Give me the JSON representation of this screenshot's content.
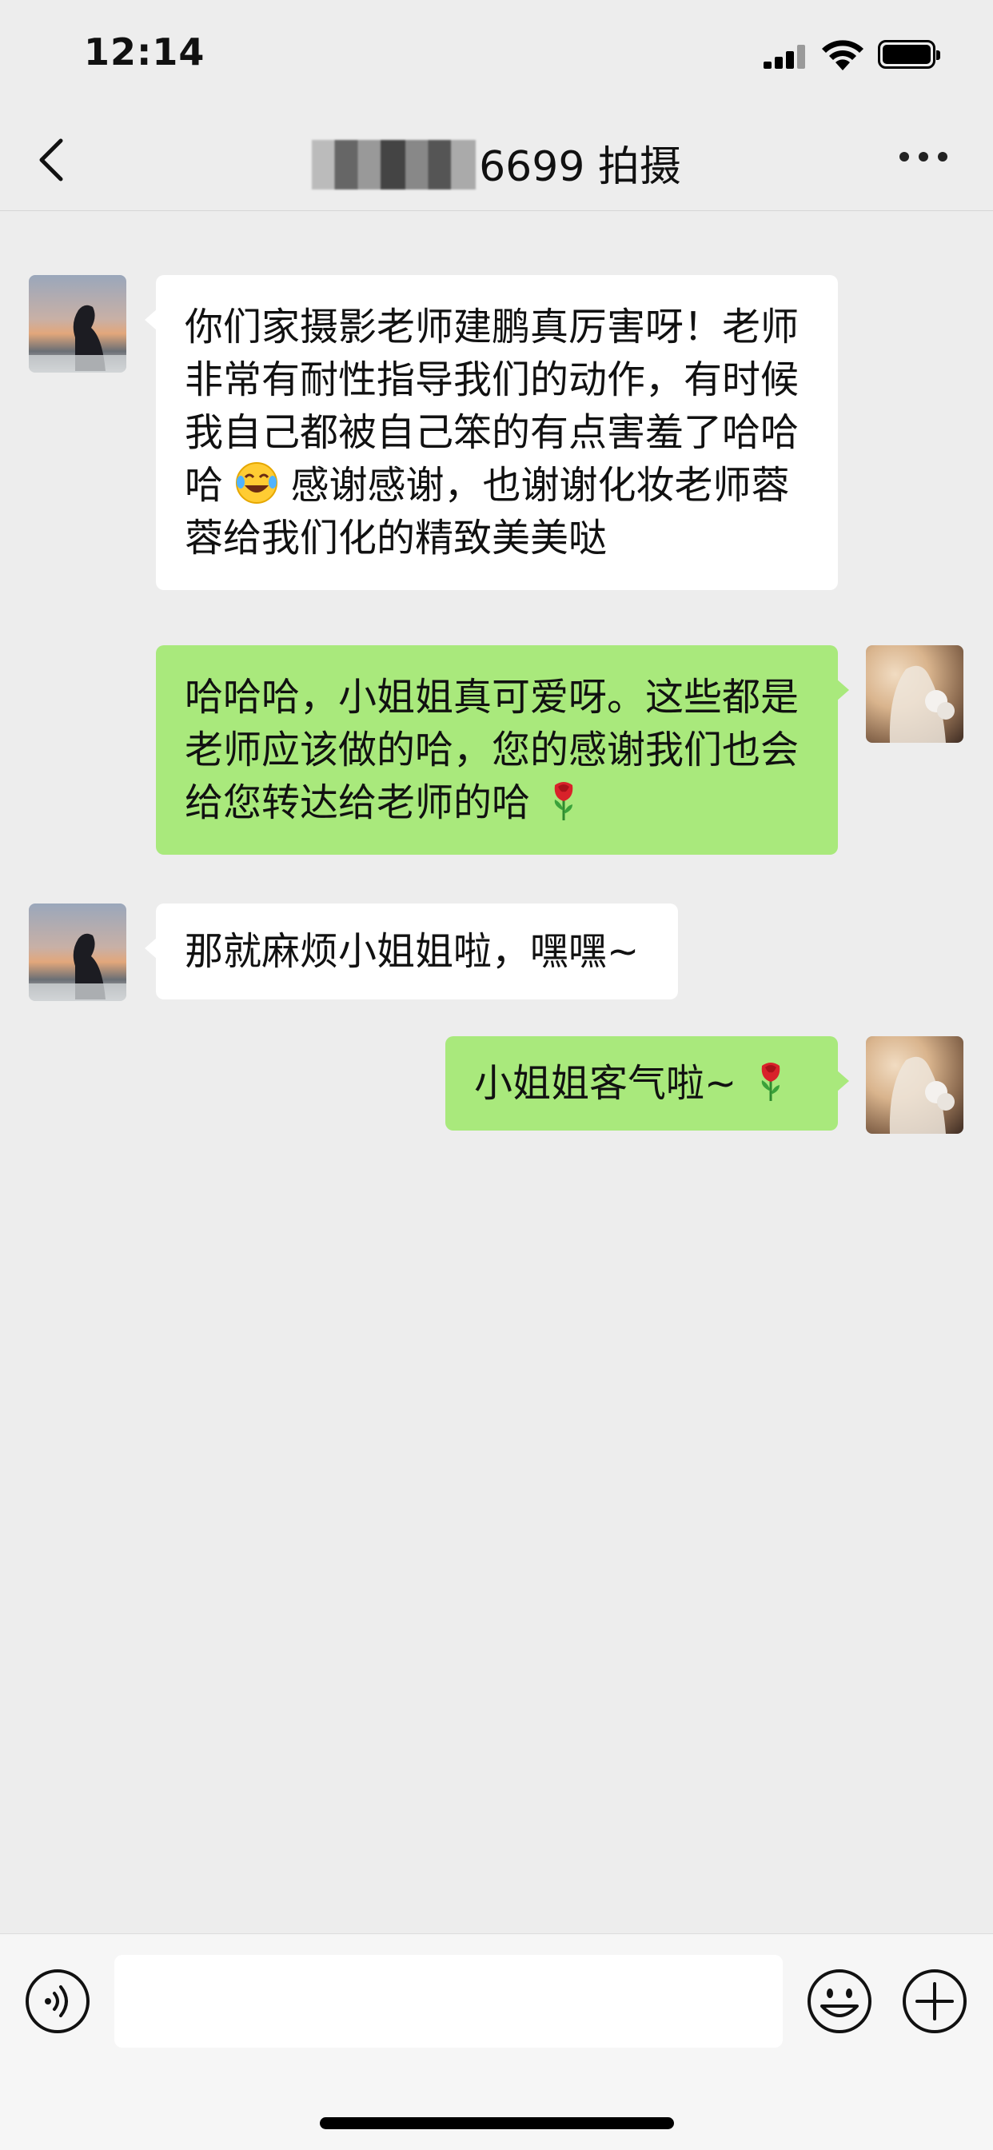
{
  "status_bar": {
    "time": "12:14"
  },
  "header": {
    "title_suffix": "6699 拍摄",
    "back_icon": "chevron-left-icon",
    "more_icon": "ellipsis-icon"
  },
  "messages": [
    {
      "direction": "incoming",
      "text_parts": [
        "你们家摄影老师建鹏真厉害呀！老师非常有耐性指导我们的动作，有时候我自己都被自己笨的有点害羞了哈哈哈",
        "感谢感谢，也谢谢化妆老师蓉蓉给我们化的精致美美哒"
      ],
      "emoji": "tears-of-joy-emoji"
    },
    {
      "direction": "outgoing",
      "text": "哈哈哈，小姐姐真可爱呀。这些都是老师应该做的哈，您的感谢我们也会给您转达给老师的哈",
      "emoji": "rose-emoji"
    },
    {
      "direction": "incoming",
      "text": "那就麻烦小姐姐啦，嘿嘿~"
    },
    {
      "direction": "outgoing",
      "text": "小姐姐客气啦~",
      "emoji": "rose-emoji"
    }
  ],
  "input_bar": {
    "voice_icon": "voice-icon",
    "text_value": "",
    "emoji_icon": "smiley-icon",
    "plus_icon": "plus-circle-icon"
  },
  "colors": {
    "background": "#ededed",
    "outgoing_bubble": "#a9e97c",
    "incoming_bubble": "#ffffff"
  }
}
